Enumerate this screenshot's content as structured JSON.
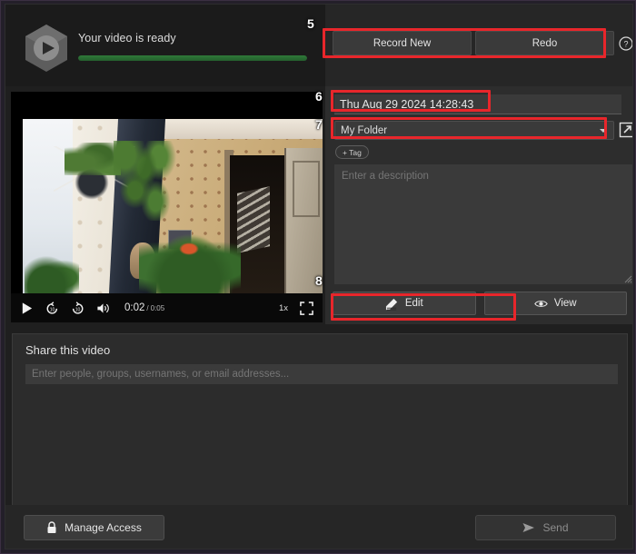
{
  "app": {
    "logo_icon": "hexagon-play-logo"
  },
  "status": {
    "message": "Your video is ready",
    "progress_percent": 100,
    "progress_color": "#2f7a39"
  },
  "actions": {
    "record_new_label": "Record New",
    "redo_label": "Redo",
    "help_icon": "question-circle-icon"
  },
  "details": {
    "title_value": "Thu Aug 29 2024 14:28:43",
    "folder_value": "My Folder",
    "folder_caret_icon": "chevron-down-icon",
    "open_folder_icon": "external-link-icon",
    "add_tag_label": "+ Tag",
    "description_placeholder": "Enter a description",
    "description_value": "",
    "edit_label": "Edit",
    "edit_icon": "pencil-edit-icon",
    "view_label": "View",
    "view_icon": "eye-icon"
  },
  "player": {
    "play_icon": "play-icon",
    "rewind_icon": "rewind-10-icon",
    "forward_icon": "forward-10-icon",
    "volume_icon": "volume-icon",
    "current_time": "0:02",
    "separator": "/",
    "total_time": "0:05",
    "speed_label": "1x",
    "fullscreen_icon": "fullscreen-icon"
  },
  "share": {
    "heading": "Share this video",
    "recipients_placeholder": "Enter people, groups, usernames, or email addresses...",
    "recipients_value": ""
  },
  "footer": {
    "manage_access_label": "Manage Access",
    "manage_access_icon": "lock-icon",
    "send_label": "Send",
    "send_icon": "send-paper-plane-icon"
  },
  "annotations": {
    "highlight_color": "#e8262b",
    "markers": [
      {
        "number": "5",
        "target": "record-new-and-redo-buttons"
      },
      {
        "number": "6",
        "target": "video-title-input"
      },
      {
        "number": "7",
        "target": "folder-select"
      },
      {
        "number": "8",
        "target": "edit-button"
      }
    ]
  }
}
